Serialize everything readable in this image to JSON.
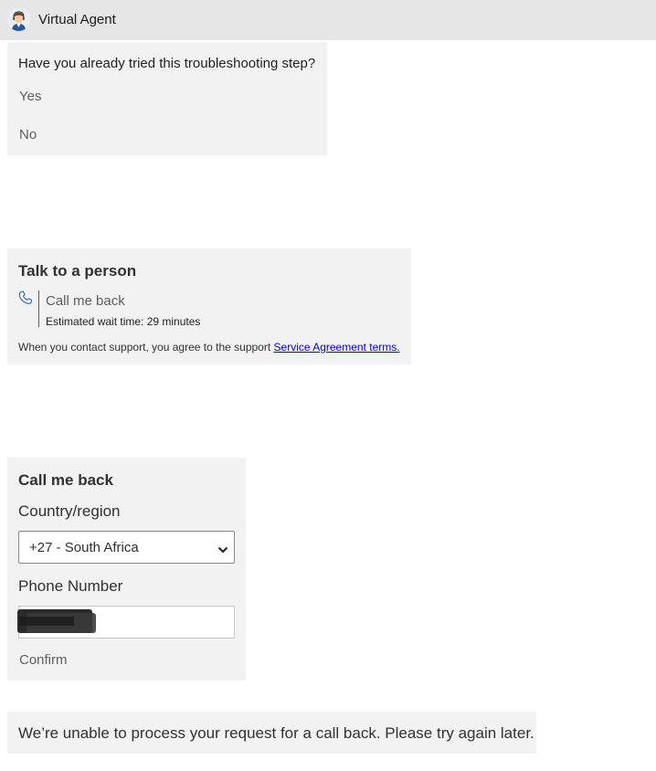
{
  "header": {
    "title": "Virtual Agent",
    "avatar_icon": "agent-avatar-icon"
  },
  "troubleshoot_card": {
    "question": "Have you already tried this troubleshooting step?",
    "choices": [
      {
        "label": "Yes"
      },
      {
        "label": "No"
      }
    ]
  },
  "talk_card": {
    "title": "Talk to a person",
    "option_icon": "phone-icon",
    "option_label": "Call me back",
    "wait_time": "Estimated wait time: 29 minutes",
    "agreement_text": "When you contact support, you agree to the support ",
    "agreement_link": "Service Agreement terms."
  },
  "callback_form": {
    "title": "Call me back",
    "country_label": "Country/region",
    "country_value": "+27 - South Africa",
    "phone_label": "Phone Number",
    "phone_value_redacted": true,
    "confirm_label": "Confirm"
  },
  "error_card": {
    "message": "We’re unable to process your request for a call back. Please try again later."
  },
  "colors": {
    "header_bg": "#e6e6e6",
    "card_bg": "#f2f2f2",
    "link": "#0000ee",
    "muted_text": "#605e5c"
  }
}
